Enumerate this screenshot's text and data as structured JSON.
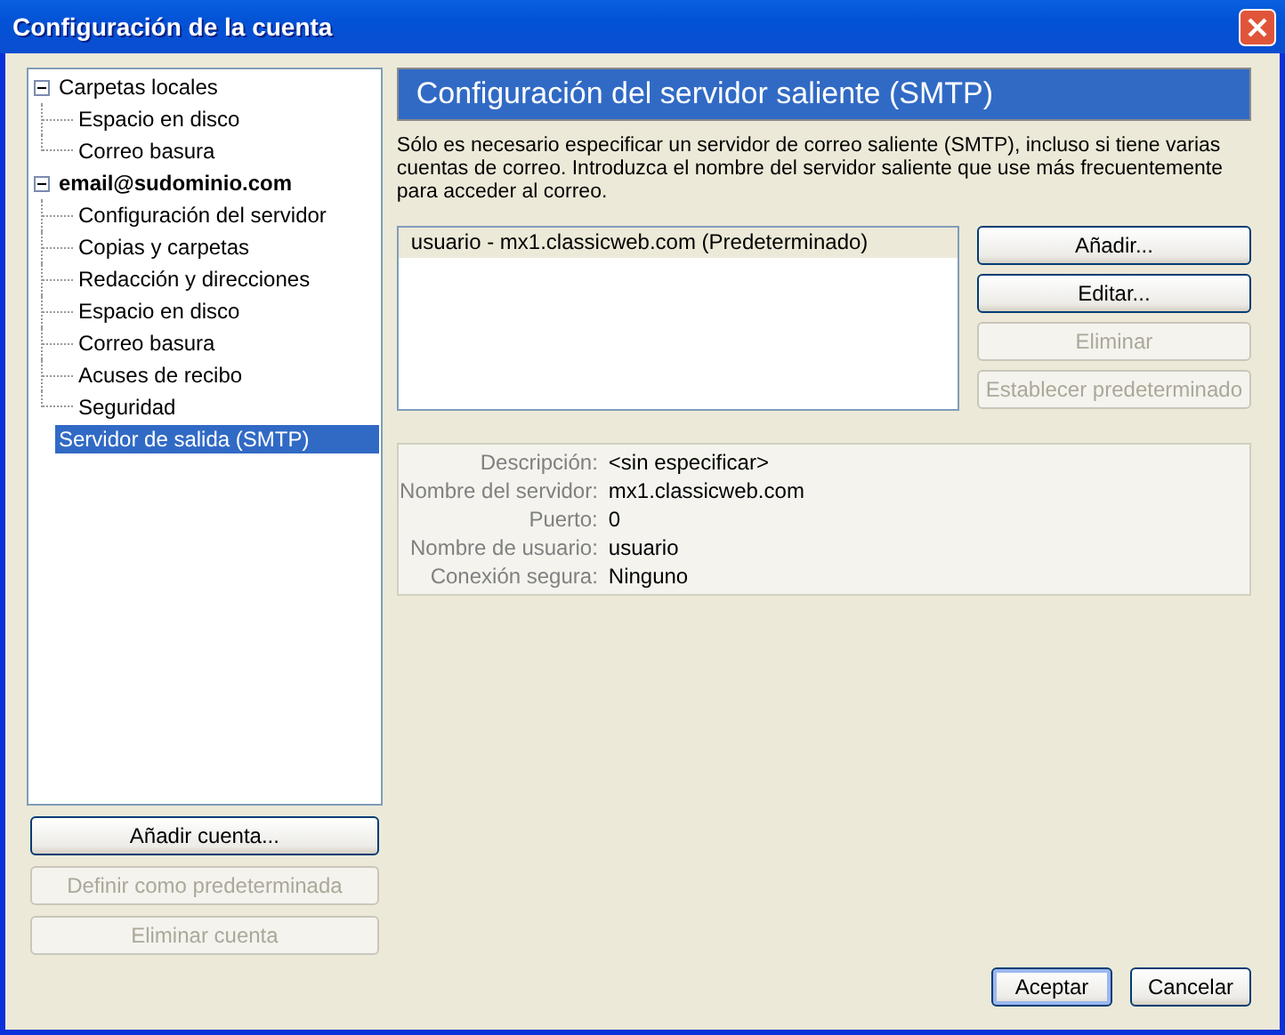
{
  "window": {
    "title": "Configuración de la cuenta"
  },
  "tree": [
    {
      "label": "Carpetas locales",
      "kind": "folder",
      "expanded": true,
      "selected": false,
      "children": [
        {
          "label": "Espacio en disco",
          "selected": false
        },
        {
          "label": "Correo basura",
          "selected": false
        }
      ]
    },
    {
      "label": "email@sudominio.com",
      "kind": "account",
      "expanded": true,
      "selected": false,
      "children": [
        {
          "label": "Configuración del servidor",
          "selected": false
        },
        {
          "label": "Copias y carpetas",
          "selected": false
        },
        {
          "label": "Redacción y direcciones",
          "selected": false
        },
        {
          "label": "Espacio en disco",
          "selected": false
        },
        {
          "label": "Correo basura",
          "selected": false
        },
        {
          "label": "Acuses de recibo",
          "selected": false
        },
        {
          "label": "Seguridad",
          "selected": false
        }
      ]
    },
    {
      "label": "Servidor de salida (SMTP)",
      "kind": "server",
      "selected": true
    }
  ],
  "account_buttons": [
    {
      "label": "Añadir cuenta...",
      "disabled": false
    },
    {
      "label": "Definir como predeterminada",
      "disabled": true
    },
    {
      "label": "Eliminar cuenta",
      "disabled": true
    }
  ],
  "panel": {
    "heading": "Configuración del servidor saliente (SMTP)",
    "description": "Sólo es necesario especificar un servidor de correo saliente (SMTP), incluso si tiene varias cuentas de correo. Introduzca el nombre del servidor saliente que use más frecuentemente para acceder al correo.",
    "servers": [
      {
        "label": "usuario - mx1.classicweb.com (Predeterminado)",
        "selected": true
      }
    ],
    "server_buttons": [
      {
        "label": "Añadir...",
        "disabled": false
      },
      {
        "label": "Editar...",
        "disabled": false
      },
      {
        "label": "Eliminar",
        "disabled": true
      },
      {
        "label": "Establecer predeterminado",
        "disabled": true
      }
    ],
    "details": [
      {
        "label": "Descripción:",
        "value": "<sin especificar>"
      },
      {
        "label": "Nombre del servidor:",
        "value": "mx1.classicweb.com"
      },
      {
        "label": "Puerto:",
        "value": "0"
      },
      {
        "label": "Nombre de usuario:",
        "value": "usuario"
      },
      {
        "label": "Conexión segura:",
        "value": "Ninguno"
      }
    ]
  },
  "dialog_buttons": [
    {
      "label": "Aceptar",
      "default": true
    },
    {
      "label": "Cancelar",
      "default": false
    }
  ]
}
